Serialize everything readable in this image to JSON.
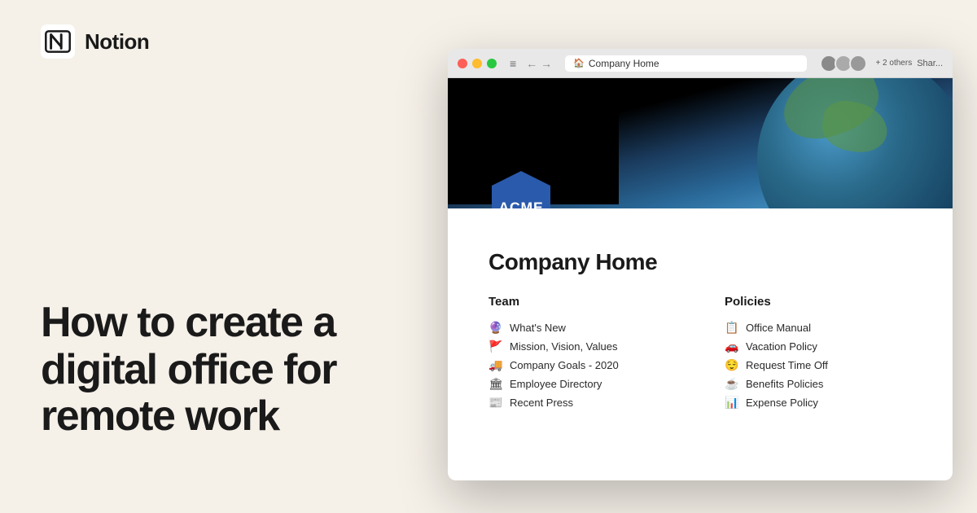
{
  "branding": {
    "logo_label": "Notion",
    "logo_icon": "notion-logo"
  },
  "headline": "How to create a digital office for remote work",
  "browser": {
    "address": "Company Home",
    "others_label": "+ 2 others",
    "share_label": "Shar...",
    "page": {
      "company_logo": "ACME",
      "title": "Company Home",
      "team_header": "Team",
      "policies_header": "Policies",
      "team_links": [
        {
          "icon": "🔮",
          "text": "What's New"
        },
        {
          "icon": "🚩",
          "text": "Mission, Vision, Values"
        },
        {
          "icon": "🚚",
          "text": "Company Goals - 2020"
        },
        {
          "icon": "🏛",
          "text": "Employee Directory"
        },
        {
          "icon": "📰",
          "text": "Recent Press"
        }
      ],
      "policy_links": [
        {
          "icon": "📋",
          "text": "Office Manual"
        },
        {
          "icon": "🚗",
          "text": "Vacation Policy"
        },
        {
          "icon": "😌",
          "text": "Request Time Off"
        },
        {
          "icon": "☕",
          "text": "Benefits Policies"
        },
        {
          "icon": "📊",
          "text": "Expense Policy"
        }
      ]
    }
  }
}
